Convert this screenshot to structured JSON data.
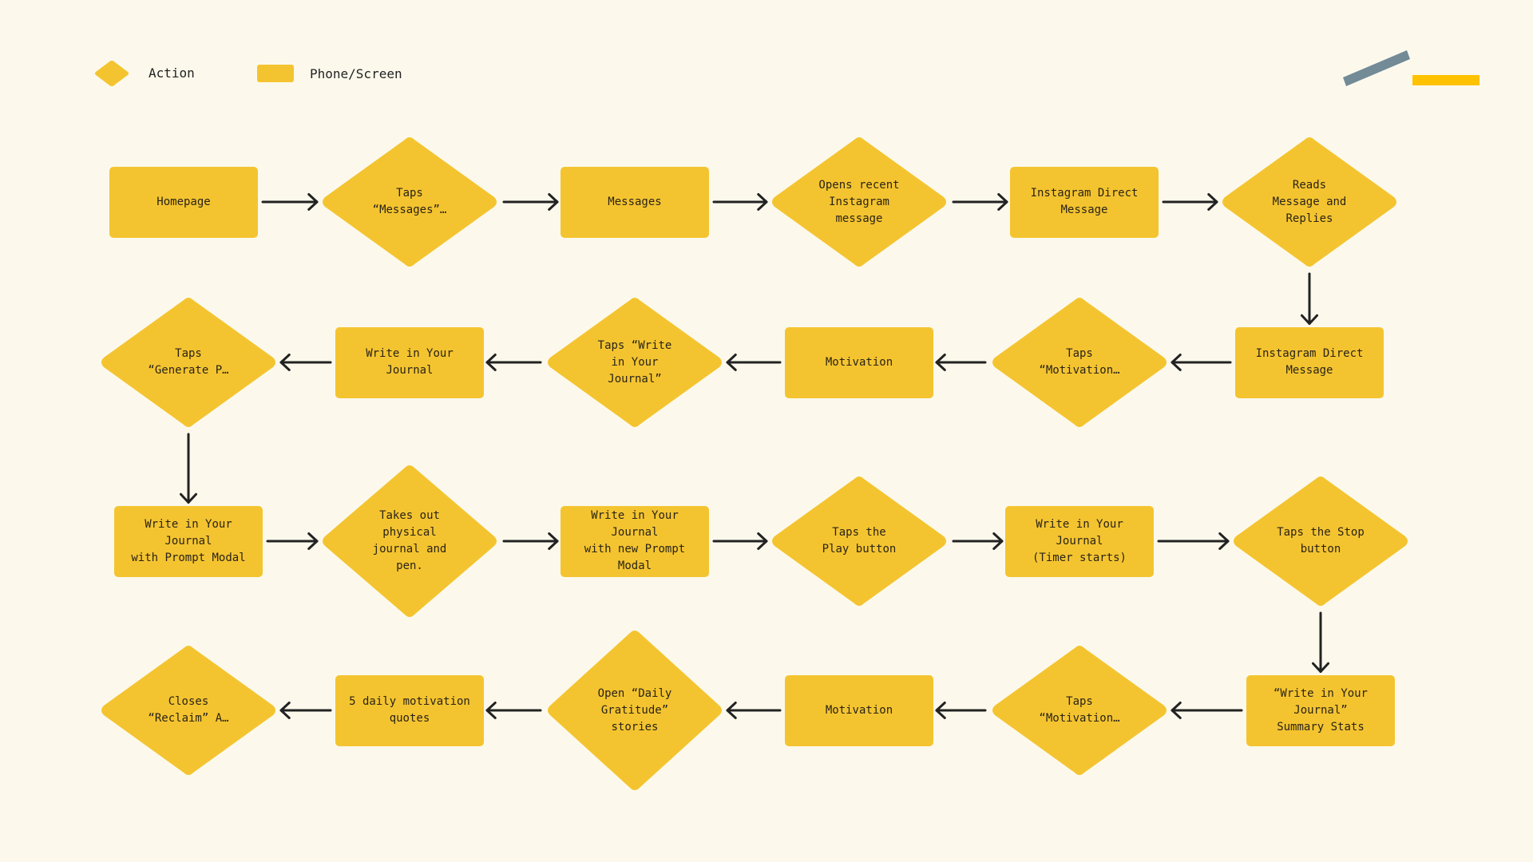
{
  "legend": {
    "action_label": "Action",
    "screen_label": "Phone/Screen"
  },
  "colors": {
    "node_fill": "#f4c430",
    "background": "#fcf9ec",
    "arrow": "#222222",
    "deco_slate": "#738a97",
    "deco_yellow": "#ffc200"
  },
  "rows": [
    {
      "direction": "right",
      "nodes": [
        {
          "type": "screen",
          "text": "Homepage"
        },
        {
          "type": "action",
          "text": "Taps\n“Messages”…"
        },
        {
          "type": "screen",
          "text": "Messages"
        },
        {
          "type": "action",
          "text": "Opens recent\nInstagram\nmessage"
        },
        {
          "type": "screen",
          "text": "Instagram Direct\nMessage"
        },
        {
          "type": "action",
          "text": "Reads\nMessage and\nReplies"
        }
      ]
    },
    {
      "direction": "left",
      "nodes": [
        {
          "type": "action",
          "text": "Taps\n“Generate P…"
        },
        {
          "type": "screen",
          "text": "Write in Your Journal"
        },
        {
          "type": "action",
          "text": "Taps “Write\nin Your\nJournal”"
        },
        {
          "type": "screen",
          "text": "Motivation"
        },
        {
          "type": "action",
          "text": "Taps\n“Motivation…"
        },
        {
          "type": "screen",
          "text": "Instagram Direct\nMessage"
        }
      ]
    },
    {
      "direction": "right",
      "nodes": [
        {
          "type": "screen",
          "text": "Write in Your Journal\nwith Prompt Modal"
        },
        {
          "type": "action",
          "text": "Takes out\nphysical\njournal and\npen."
        },
        {
          "type": "screen",
          "text": "Write in Your Journal\nwith new Prompt Modal"
        },
        {
          "type": "action",
          "text": "Taps the\nPlay button"
        },
        {
          "type": "screen",
          "text": "Write in Your Journal\n(Timer starts)"
        },
        {
          "type": "action",
          "text": "Taps the Stop\nbutton"
        }
      ]
    },
    {
      "direction": "left",
      "nodes": [
        {
          "type": "action",
          "text": "Closes\n“Reclaim” A…"
        },
        {
          "type": "screen",
          "text": "5 daily motivation\nquotes"
        },
        {
          "type": "action",
          "text": "Open “Daily\nGratitude”\nstories"
        },
        {
          "type": "screen",
          "text": "Motivation"
        },
        {
          "type": "action",
          "text": "Taps\n“Motivation…"
        },
        {
          "type": "screen",
          "text": "“Write in Your\nJournal”\nSummary Stats"
        }
      ]
    }
  ]
}
